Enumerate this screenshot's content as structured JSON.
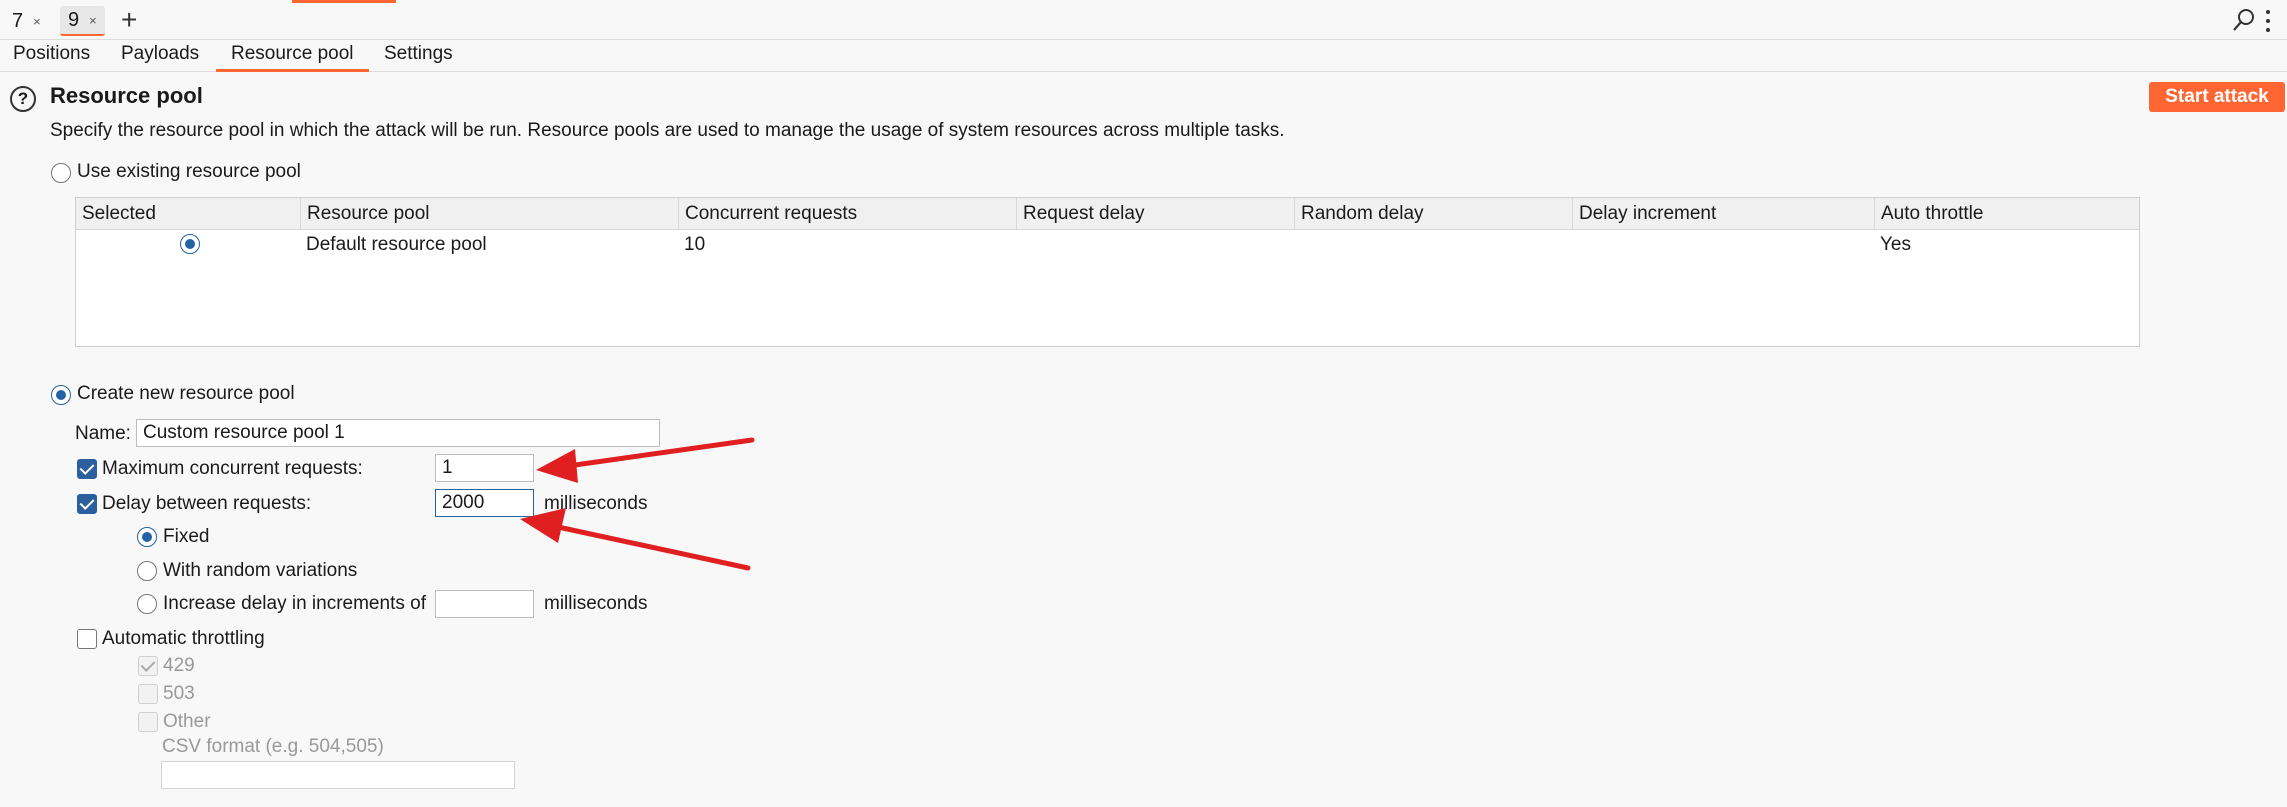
{
  "tabstrip": {
    "tabs": [
      {
        "label": "7",
        "close": "×"
      },
      {
        "label": "9",
        "close": "×"
      }
    ],
    "add": "+"
  },
  "subtabs": [
    "Positions",
    "Payloads",
    "Resource pool",
    "Settings"
  ],
  "section": {
    "title": "Resource pool",
    "help": "?",
    "start_button": "Start attack",
    "description": "Specify the resource pool in which the attack will be run. Resource pools are used to manage the usage of system resources across multiple tasks."
  },
  "existing": {
    "label": "Use existing resource pool",
    "columns": [
      "Selected",
      "Resource pool",
      "Concurrent requests",
      "Request delay",
      "Random delay",
      "Delay increment",
      "Auto throttle"
    ],
    "rows": [
      {
        "name": "Default resource pool",
        "concurrent": "10",
        "request_delay": "",
        "random_delay": "",
        "delay_increment": "",
        "auto_throttle": "Yes"
      }
    ]
  },
  "create": {
    "label": "Create new resource pool",
    "name_label": "Name:",
    "name_value": "Custom resource pool 1",
    "max_concurrent_label": "Maximum concurrent requests:",
    "max_concurrent_value": "1",
    "delay_label": "Delay between requests:",
    "delay_value": "2000",
    "delay_unit": "milliseconds",
    "fixed_label": "Fixed",
    "random_label": "With random variations",
    "increment_label": "Increase delay in increments of",
    "increment_value": "",
    "increment_unit": "milliseconds",
    "throttle_label": "Automatic throttling",
    "codes": [
      "429",
      "503",
      "Other"
    ],
    "csv_label": "CSV format (e.g. 504,505)",
    "csv_value": ""
  },
  "colors": {
    "accent": "#ff6633",
    "selection": "#2462a6",
    "arrow": "#e02020"
  }
}
